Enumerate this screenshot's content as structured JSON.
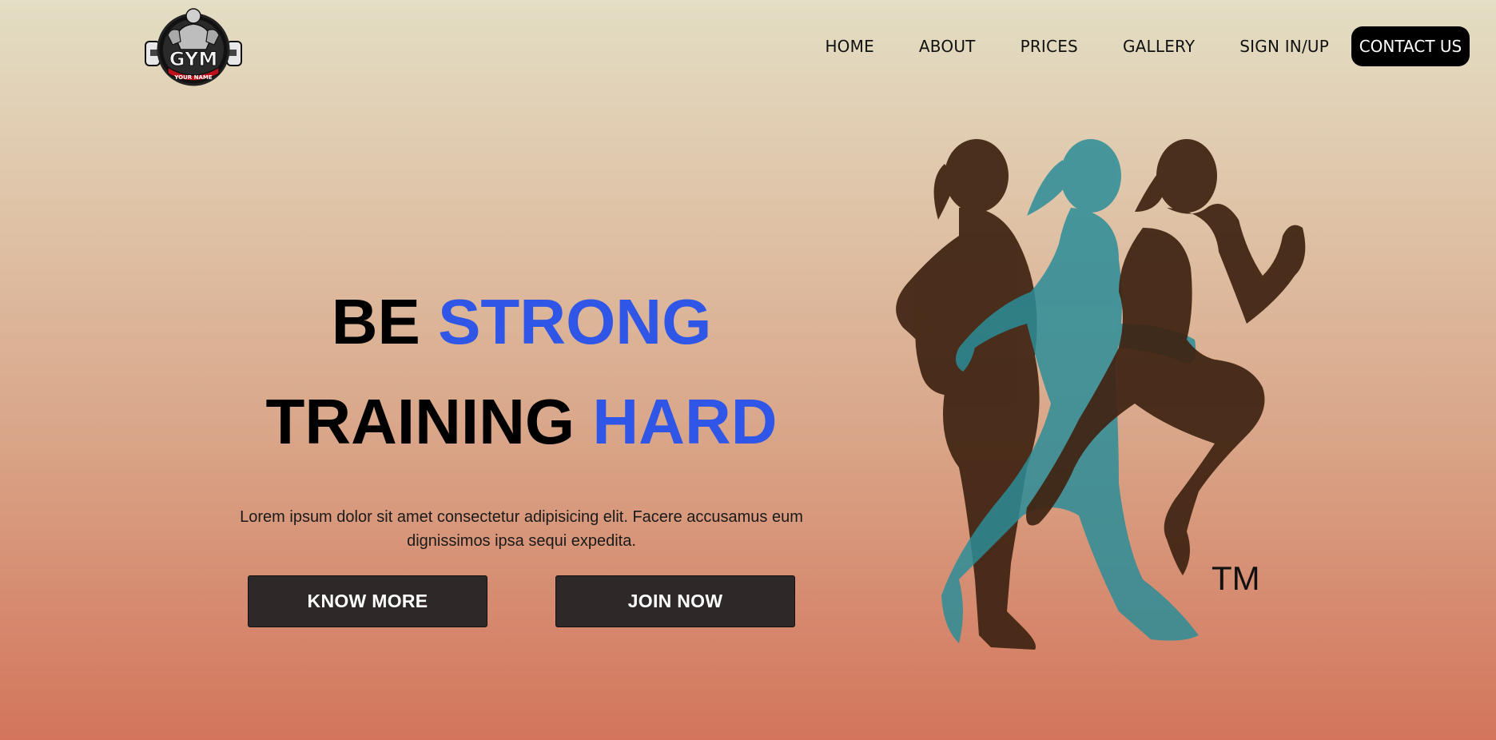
{
  "logo": {
    "title": "GYM",
    "subtitle": "YOUR NAME"
  },
  "nav": {
    "items": [
      "HOME",
      "ABOUT",
      "PRICES",
      "GALLERY",
      "SIGN IN/UP"
    ],
    "cta": "CONTACT US"
  },
  "hero": {
    "line1_a": "BE",
    "line1_b": "STRONG",
    "line2_a": "TRAINING",
    "line2_b": "HARD",
    "description": "Lorem ipsum dolor sit amet consectetur adipisicing elit. Facere accusamus eum dignissimos ipsa sequi expedita.",
    "buttons": {
      "know_more": "KNOW MORE",
      "join_now": "JOIN NOW"
    }
  },
  "illustration": {
    "trademark": "TM"
  },
  "colors": {
    "accent": "#2f56e6",
    "button_bg": "#2e2828",
    "cta_bg": "#000000",
    "figure_dark": "#3f2412",
    "figure_teal": "#2b8d98"
  }
}
